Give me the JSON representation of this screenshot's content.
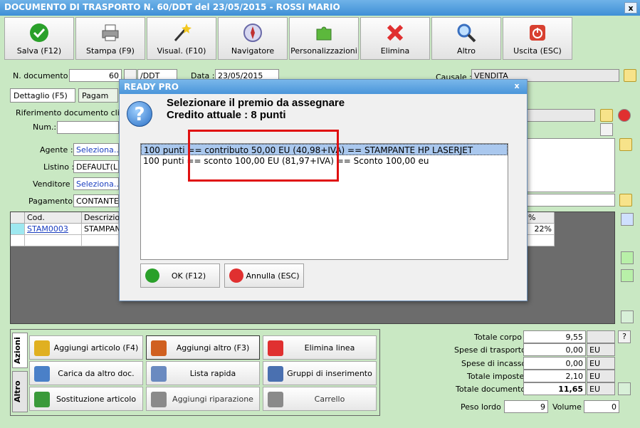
{
  "window": {
    "title": "DOCUMENTO DI TRASPORTO N. 60/DDT del 23/05/2015 - ROSSI MARIO",
    "close": "x"
  },
  "toolbar": [
    {
      "label": "Salva (F12)",
      "icon": "check-icon",
      "color": "#2aa02a"
    },
    {
      "label": "Stampa (F9)",
      "icon": "printer-icon",
      "color": "#8c8c8c"
    },
    {
      "label": "Visual. (F10)",
      "icon": "wand-icon",
      "color": "#333333"
    },
    {
      "label": "Navigatore",
      "icon": "compass-icon",
      "color": "#6a6aa8"
    },
    {
      "label": "Personalizzazioni",
      "icon": "puzzle-icon",
      "color": "#5cb83c"
    },
    {
      "label": "Elimina",
      "icon": "delete-x-icon",
      "color": "#e03030"
    },
    {
      "label": "Altro",
      "icon": "magnifier-icon",
      "color": "#3a70c0"
    },
    {
      "label": "Uscita (ESC)",
      "icon": "power-icon",
      "color": "#d84030"
    }
  ],
  "header": {
    "num_label": "N. documento :",
    "num_value": "60",
    "series_value": "/DDT",
    "date_label": "Data :",
    "date_value": "23/05/2015",
    "causale_label": "Causale :",
    "causale_value": "VENDITA"
  },
  "tabs": {
    "dettaglio": "Dettaglio (F5)",
    "pagamenti": "Pagam"
  },
  "form": {
    "rif_label": "Riferimento documento cliente",
    "num_label": "Num.:",
    "agente_label": "Agente :",
    "agente_value": "Seleziona...",
    "listino_label": "Listino :",
    "listino_value": "DEFAULT(Lis",
    "venditore_label": "Venditore :",
    "venditore_value": "Seleziona...",
    "pagamento_label": "Pagamento :",
    "pagamento_value": "CONTANTE A"
  },
  "grid": {
    "headers": {
      "cod": "Cod.",
      "descr": "Descrizione",
      "imp": "% imp."
    },
    "row": {
      "cod": "STAM0003",
      "descr": "STAMPANT",
      "imp": "22%"
    }
  },
  "actions": {
    "side_tabs": [
      "Azioni",
      "Altro"
    ],
    "buttons": [
      {
        "label": "Aggiungi articolo (F4)",
        "icon": "add-item-icon",
        "color": "#e0b020"
      },
      {
        "label": "Aggiungi altro (F3)",
        "icon": "add-other-icon",
        "color": "#d06020"
      },
      {
        "label": "Elimina linea",
        "icon": "delete-line-icon",
        "color": "#e03030"
      },
      {
        "label": "Carica da altro doc.",
        "icon": "load-doc-icon",
        "color": "#4a80c8"
      },
      {
        "label": "Lista rapida",
        "icon": "quick-list-icon",
        "color": "#6a8ac0"
      },
      {
        "label": "Gruppi di inserimento",
        "icon": "groups-icon",
        "color": "#4a70b0"
      },
      {
        "label": "Sostituzione articolo",
        "icon": "replace-item-icon",
        "color": "#3a9a3a"
      },
      {
        "label": "Aggiungi riparazione",
        "icon": "wrench-icon",
        "color": "#8a8a8a"
      },
      {
        "label": "Carrello",
        "icon": "cart-icon",
        "color": "#8a8a8a"
      }
    ]
  },
  "totals": {
    "corpo_label": "Totale corpo :",
    "corpo_value": "9,55",
    "help": "?",
    "trasporto_label": "Spese di trasporto :",
    "trasporto_value": "0,00",
    "incasso_label": "Spese di incasso :",
    "incasso_value": "0,00",
    "imposte_label": "Totale imposte :",
    "imposte_value": "2,10",
    "documento_label": "Totale documento :",
    "documento_value": "11,65",
    "currency": "EU",
    "peso_label": "Peso lordo :",
    "peso_value": "9",
    "volume_label": "Volume :",
    "volume_value": "0"
  },
  "dialog": {
    "title": "READY PRO",
    "close": "x",
    "line1": "Selezionare il premio da assegnare",
    "line2": "Credito attuale : 8 punti",
    "options": [
      "100 punti == contributo 50,00 EU (40,98+IVA) == STAMPANTE HP LASERJET",
      "100 punti == sconto 100,00 EU (81,97+IVA) == Sconto 100,00 eu"
    ],
    "ok_label": "OK (F12)",
    "cancel_label": "Annulla (ESC)"
  }
}
